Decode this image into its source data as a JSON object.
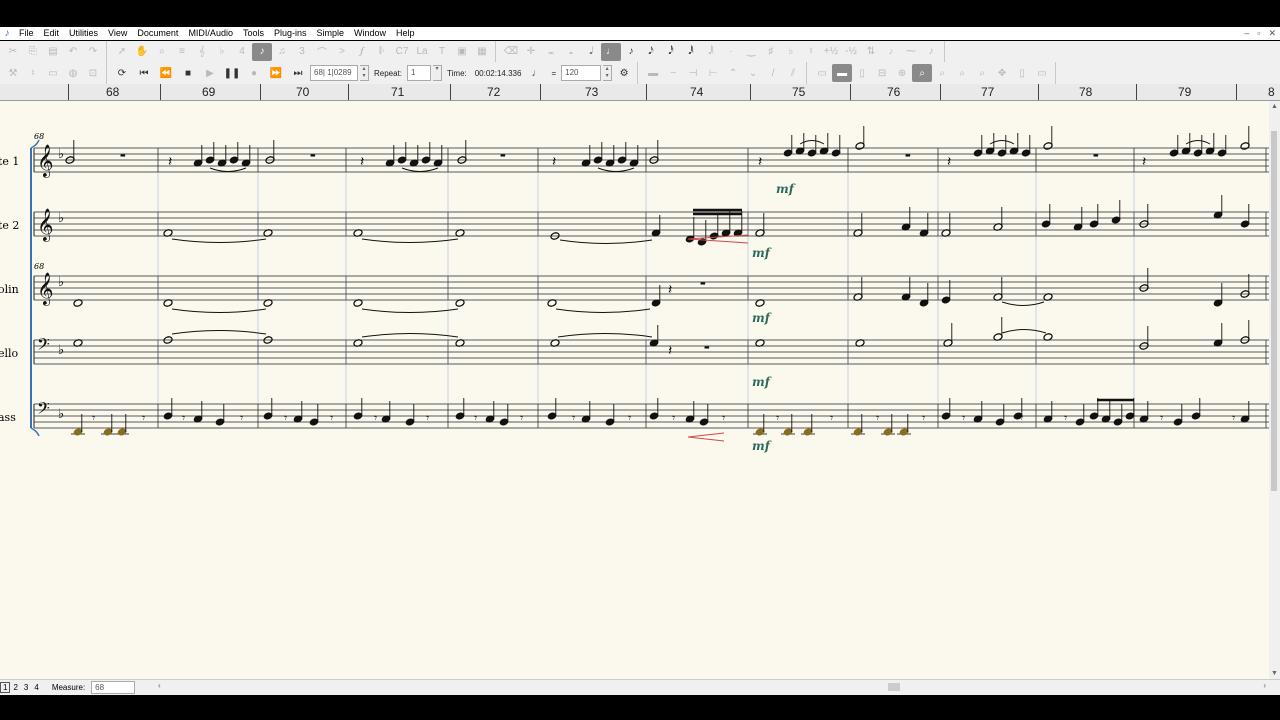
{
  "menu": {
    "items": [
      "File",
      "Edit",
      "Utilities",
      "View",
      "Document",
      "MIDI/Audio",
      "Tools",
      "Plug-ins",
      "Simple",
      "Window",
      "Help"
    ],
    "window_controls": [
      "–",
      "▫",
      "✕"
    ]
  },
  "playback": {
    "position": "68| 1|0289",
    "repeat_label": "Repeat:",
    "repeat_value": "1",
    "time_label": "Time:",
    "time_value": "00:02:14.336",
    "tempo_equals": "=",
    "tempo_value": "120"
  },
  "ruler": {
    "measures": [
      "68",
      "69",
      "70",
      "71",
      "72",
      "73",
      "74",
      "75",
      "76",
      "77",
      "78",
      "79",
      "8"
    ]
  },
  "score": {
    "staff_names": [
      "te 1",
      "te 2",
      "olin",
      "ello",
      "ass"
    ],
    "measure_number_top": "68",
    "measure_number_strings": "68",
    "dynamics": [
      "mf",
      "mf",
      "mf",
      "mf",
      "mf"
    ]
  },
  "status": {
    "pages": [
      "1",
      "2",
      "3",
      "4"
    ],
    "measure_label": "Measure:",
    "measure_value": "68"
  },
  "colors": {
    "canvas": "#fbf8ee",
    "dynamic": "#2f6a5e",
    "hairpin": "#d04848",
    "highlight_note": "#c8a12a",
    "system_line": "#3a6fb0"
  },
  "icons": {
    "toolbar1": [
      "cut-icon",
      "copy-icon",
      "paste-icon",
      "undo-icon",
      "redo-icon",
      "select-icon",
      "hand-icon",
      "zoom-icon",
      "staff-icon",
      "note-icon",
      "rest-icon",
      "clef-icon",
      "key-icon",
      "time-icon",
      "slur-icon",
      "text-icon",
      "lyrics-icon",
      "chord-icon",
      "expression-icon",
      "articulation-icon",
      "smart-shape-icon",
      "repeat-icon",
      "measure-icon",
      "tuplet-icon",
      "speedy-entry-icon",
      "simple-entry-icon",
      "dot-icon",
      "sharp-icon",
      "flat-icon",
      "natural-icon"
    ],
    "toolbar2": [
      "wrench-icon",
      "tuner-icon",
      "camera-icon",
      "metronome-icon",
      "scroll-view-icon",
      "loop-icon",
      "rewind-start-icon",
      "rewind-icon",
      "stop-icon",
      "play-icon",
      "pause-icon",
      "record-icon",
      "fast-forward-icon",
      "forward-end-icon",
      "settings-icon"
    ]
  }
}
